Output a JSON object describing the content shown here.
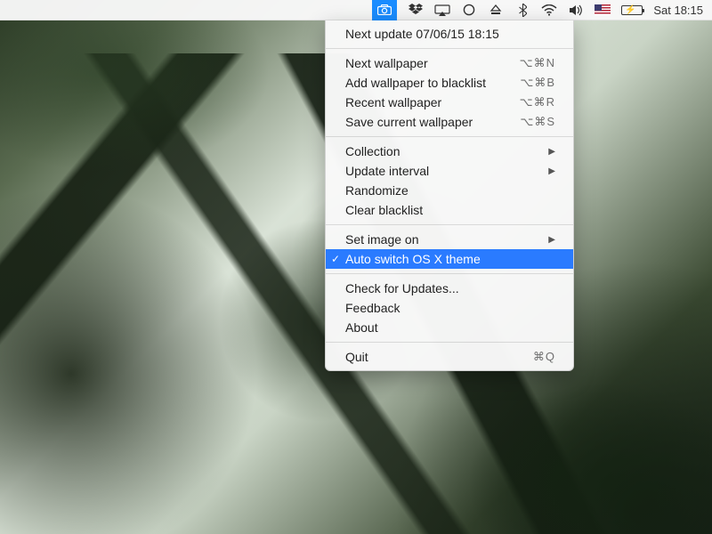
{
  "menubar": {
    "clock": "Sat 18:15",
    "icons": {
      "camera": "camera-icon",
      "dropbox": "dropbox-icon",
      "airplay": "airplay-icon",
      "circle": "app-circle-icon",
      "eject": "eject-icon",
      "bluetooth": "bluetooth-icon",
      "wifi": "wifi-icon",
      "volume": "volume-icon",
      "flag": "us-flag-icon",
      "battery": "battery-charging-icon"
    }
  },
  "menu": {
    "header": "Next update 07/06/15 18:15",
    "group1": [
      {
        "label": "Next wallpaper",
        "shortcut": "⌥⌘N"
      },
      {
        "label": "Add wallpaper to blacklist",
        "shortcut": "⌥⌘B"
      },
      {
        "label": "Recent wallpaper",
        "shortcut": "⌥⌘R"
      },
      {
        "label": "Save current wallpaper",
        "shortcut": "⌥⌘S"
      }
    ],
    "group2": [
      {
        "label": "Collection",
        "submenu": true
      },
      {
        "label": "Update interval",
        "submenu": true
      },
      {
        "label": "Randomize"
      },
      {
        "label": "Clear blacklist"
      }
    ],
    "group3": [
      {
        "label": "Set image on",
        "submenu": true
      },
      {
        "label": "Auto switch OS X theme",
        "checked": true,
        "selected": true
      }
    ],
    "group4": [
      {
        "label": "Check for Updates..."
      },
      {
        "label": "Feedback"
      },
      {
        "label": "About"
      }
    ],
    "group5": [
      {
        "label": "Quit",
        "shortcut": "⌘Q"
      }
    ]
  }
}
